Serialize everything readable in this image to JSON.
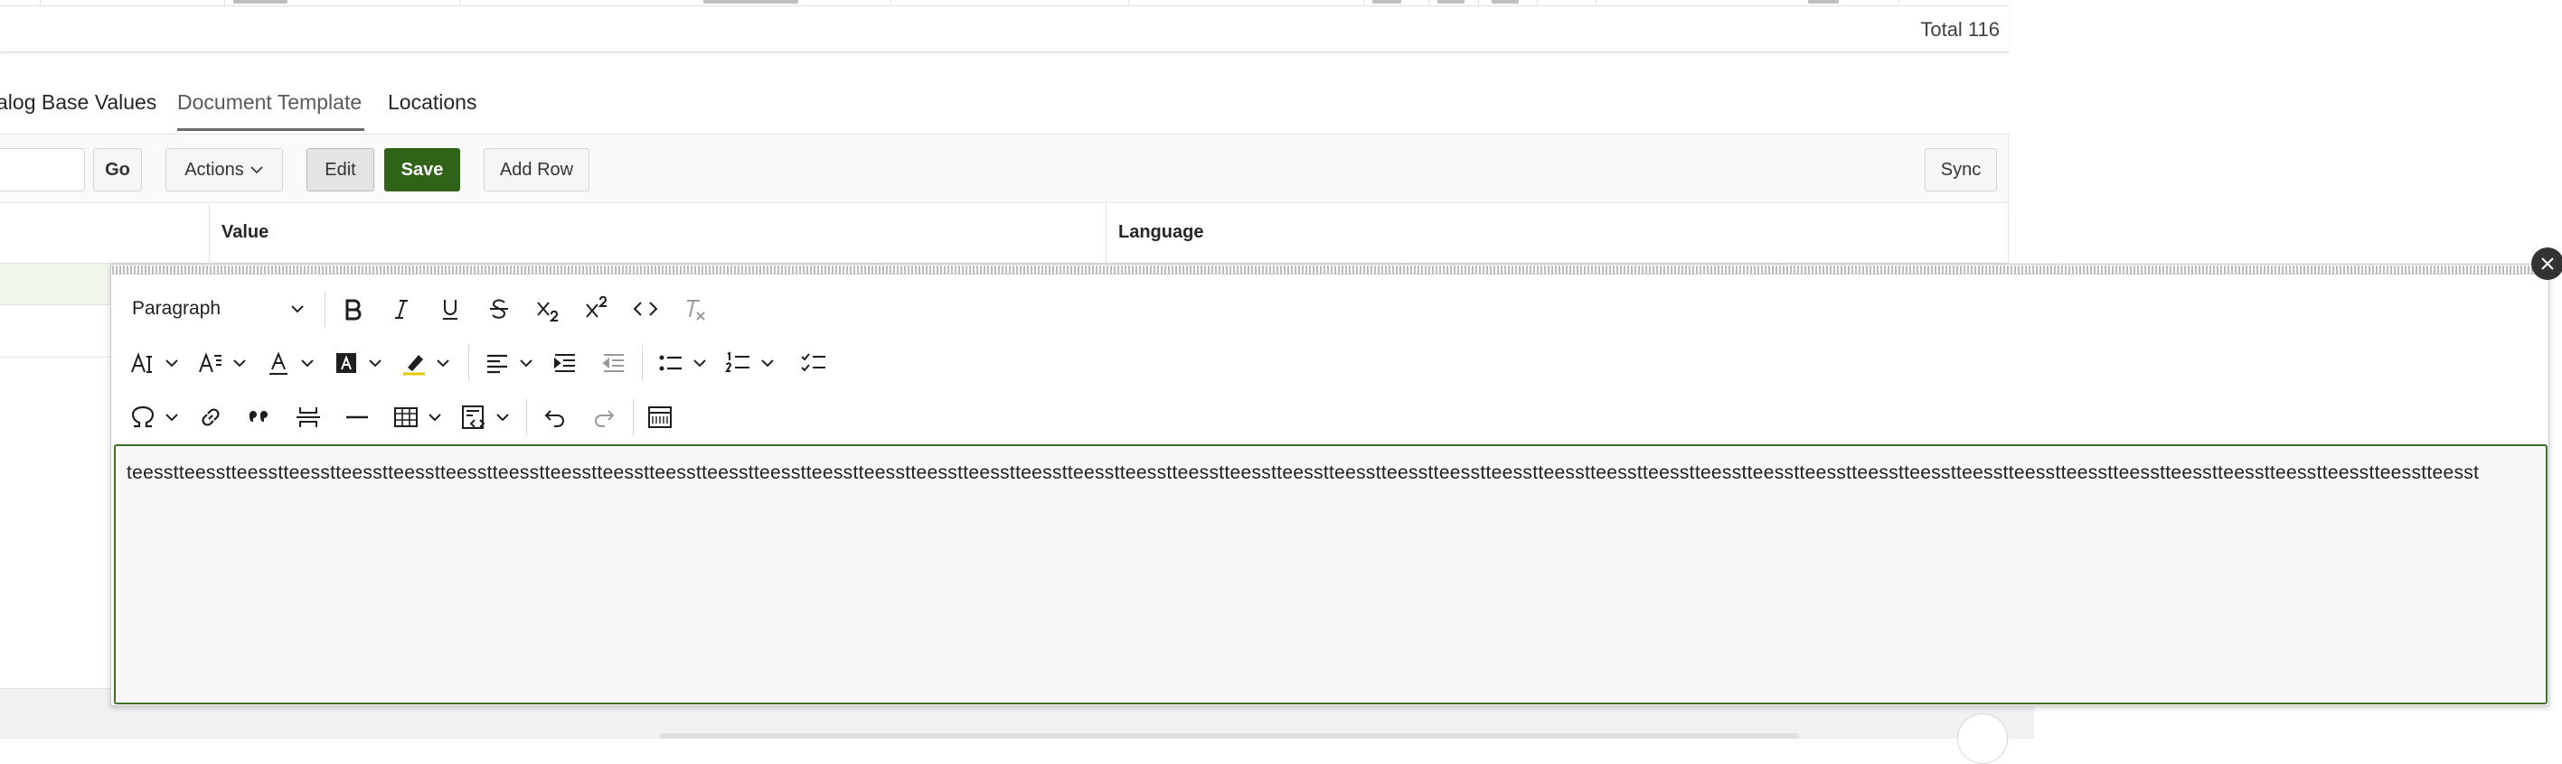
{
  "top_table": {
    "total": "Total 116"
  },
  "tabs": [
    {
      "label": "alog Base Values"
    },
    {
      "label": "Document Template"
    },
    {
      "label": "Locations"
    }
  ],
  "toolbar": {
    "go_label": "Go",
    "actions_label": "Actions",
    "edit_label": "Edit",
    "save_label": "Save",
    "add_row_label": "Add Row",
    "sync_label": "Sync"
  },
  "grid": {
    "columns": [
      {
        "label": "Value"
      },
      {
        "label": "Language"
      }
    ]
  },
  "editor": {
    "format_value": "Paragraph",
    "content": "teesstteesstteesstteesstteesstteesstteesstteesstteesstteesstteesstteesstteesstteesstteesstteesstteesstteesstteesstteesstteesstteesstteesstteesstteesstteesstteesstteesstteesstteesstteesstteesstteesstteesstteesstteesstteesstteesstteesstteesstteesstteesstteesstteesstteesst",
    "icons": [
      "bold-icon",
      "italic-icon",
      "underline-icon",
      "strikethrough-icon",
      "subscript-icon",
      "superscript-icon",
      "code-icon",
      "clear-formatting-icon",
      "font-size-icon",
      "line-height-icon",
      "font-color-icon",
      "background-color-icon",
      "highlight-icon",
      "align-icon",
      "indent-icon",
      "outdent-icon",
      "bulleted-list-icon",
      "numbered-list-icon",
      "todo-list-icon",
      "special-characters-icon",
      "link-icon",
      "blockquote-icon",
      "page-break-icon",
      "horizontal-line-icon",
      "table-icon",
      "insert-template-icon",
      "undo-icon",
      "redo-icon",
      "source-editing-icon",
      "close-icon"
    ],
    "colors": {
      "accent": "#2e6318",
      "focus_border": "#3f6f28",
      "close_bg": "#333333"
    }
  }
}
